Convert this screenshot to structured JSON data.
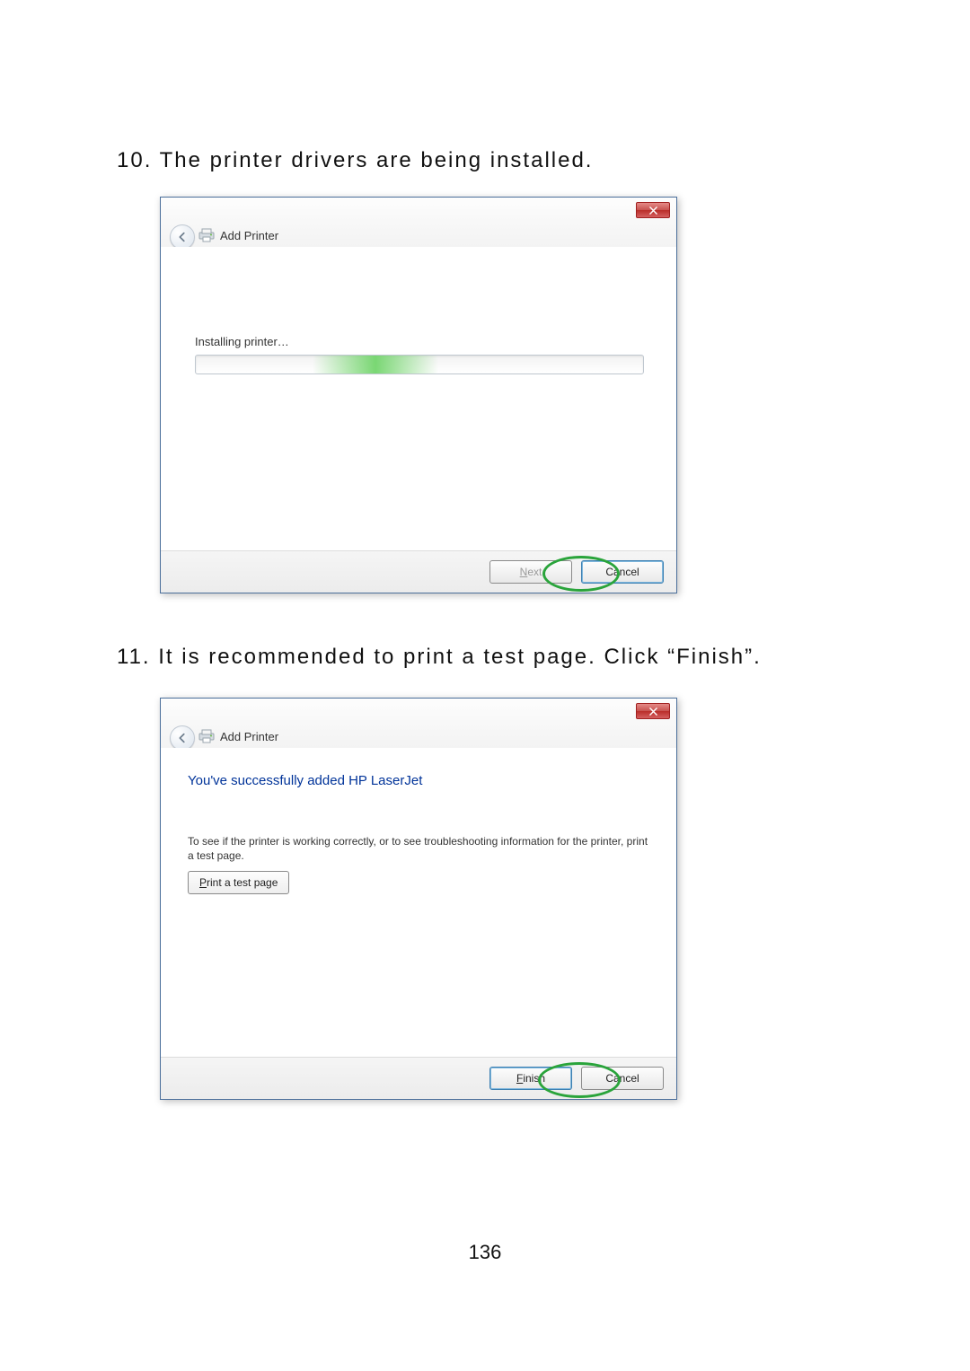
{
  "steps": {
    "s10": "10. The printer drivers are being installed.",
    "s11": "11. It is recommended to print a test page. Click “Finish”."
  },
  "page_number": "136",
  "dialog1": {
    "title": "Add Printer",
    "progress_label": "Installing printer…",
    "next_letter": "N",
    "next_rest": "ext",
    "cancel_label": "Cancel"
  },
  "dialog2": {
    "title": "Add Printer",
    "success_heading": "You've successfully added HP LaserJet",
    "description": "To see if the printer is working correctly, or to see troubleshooting information for the printer, print a test page.",
    "print_letter": "P",
    "print_rest": "rint a test page",
    "finish_letter": "F",
    "finish_rest": "inish",
    "cancel_label": "Cancel"
  }
}
